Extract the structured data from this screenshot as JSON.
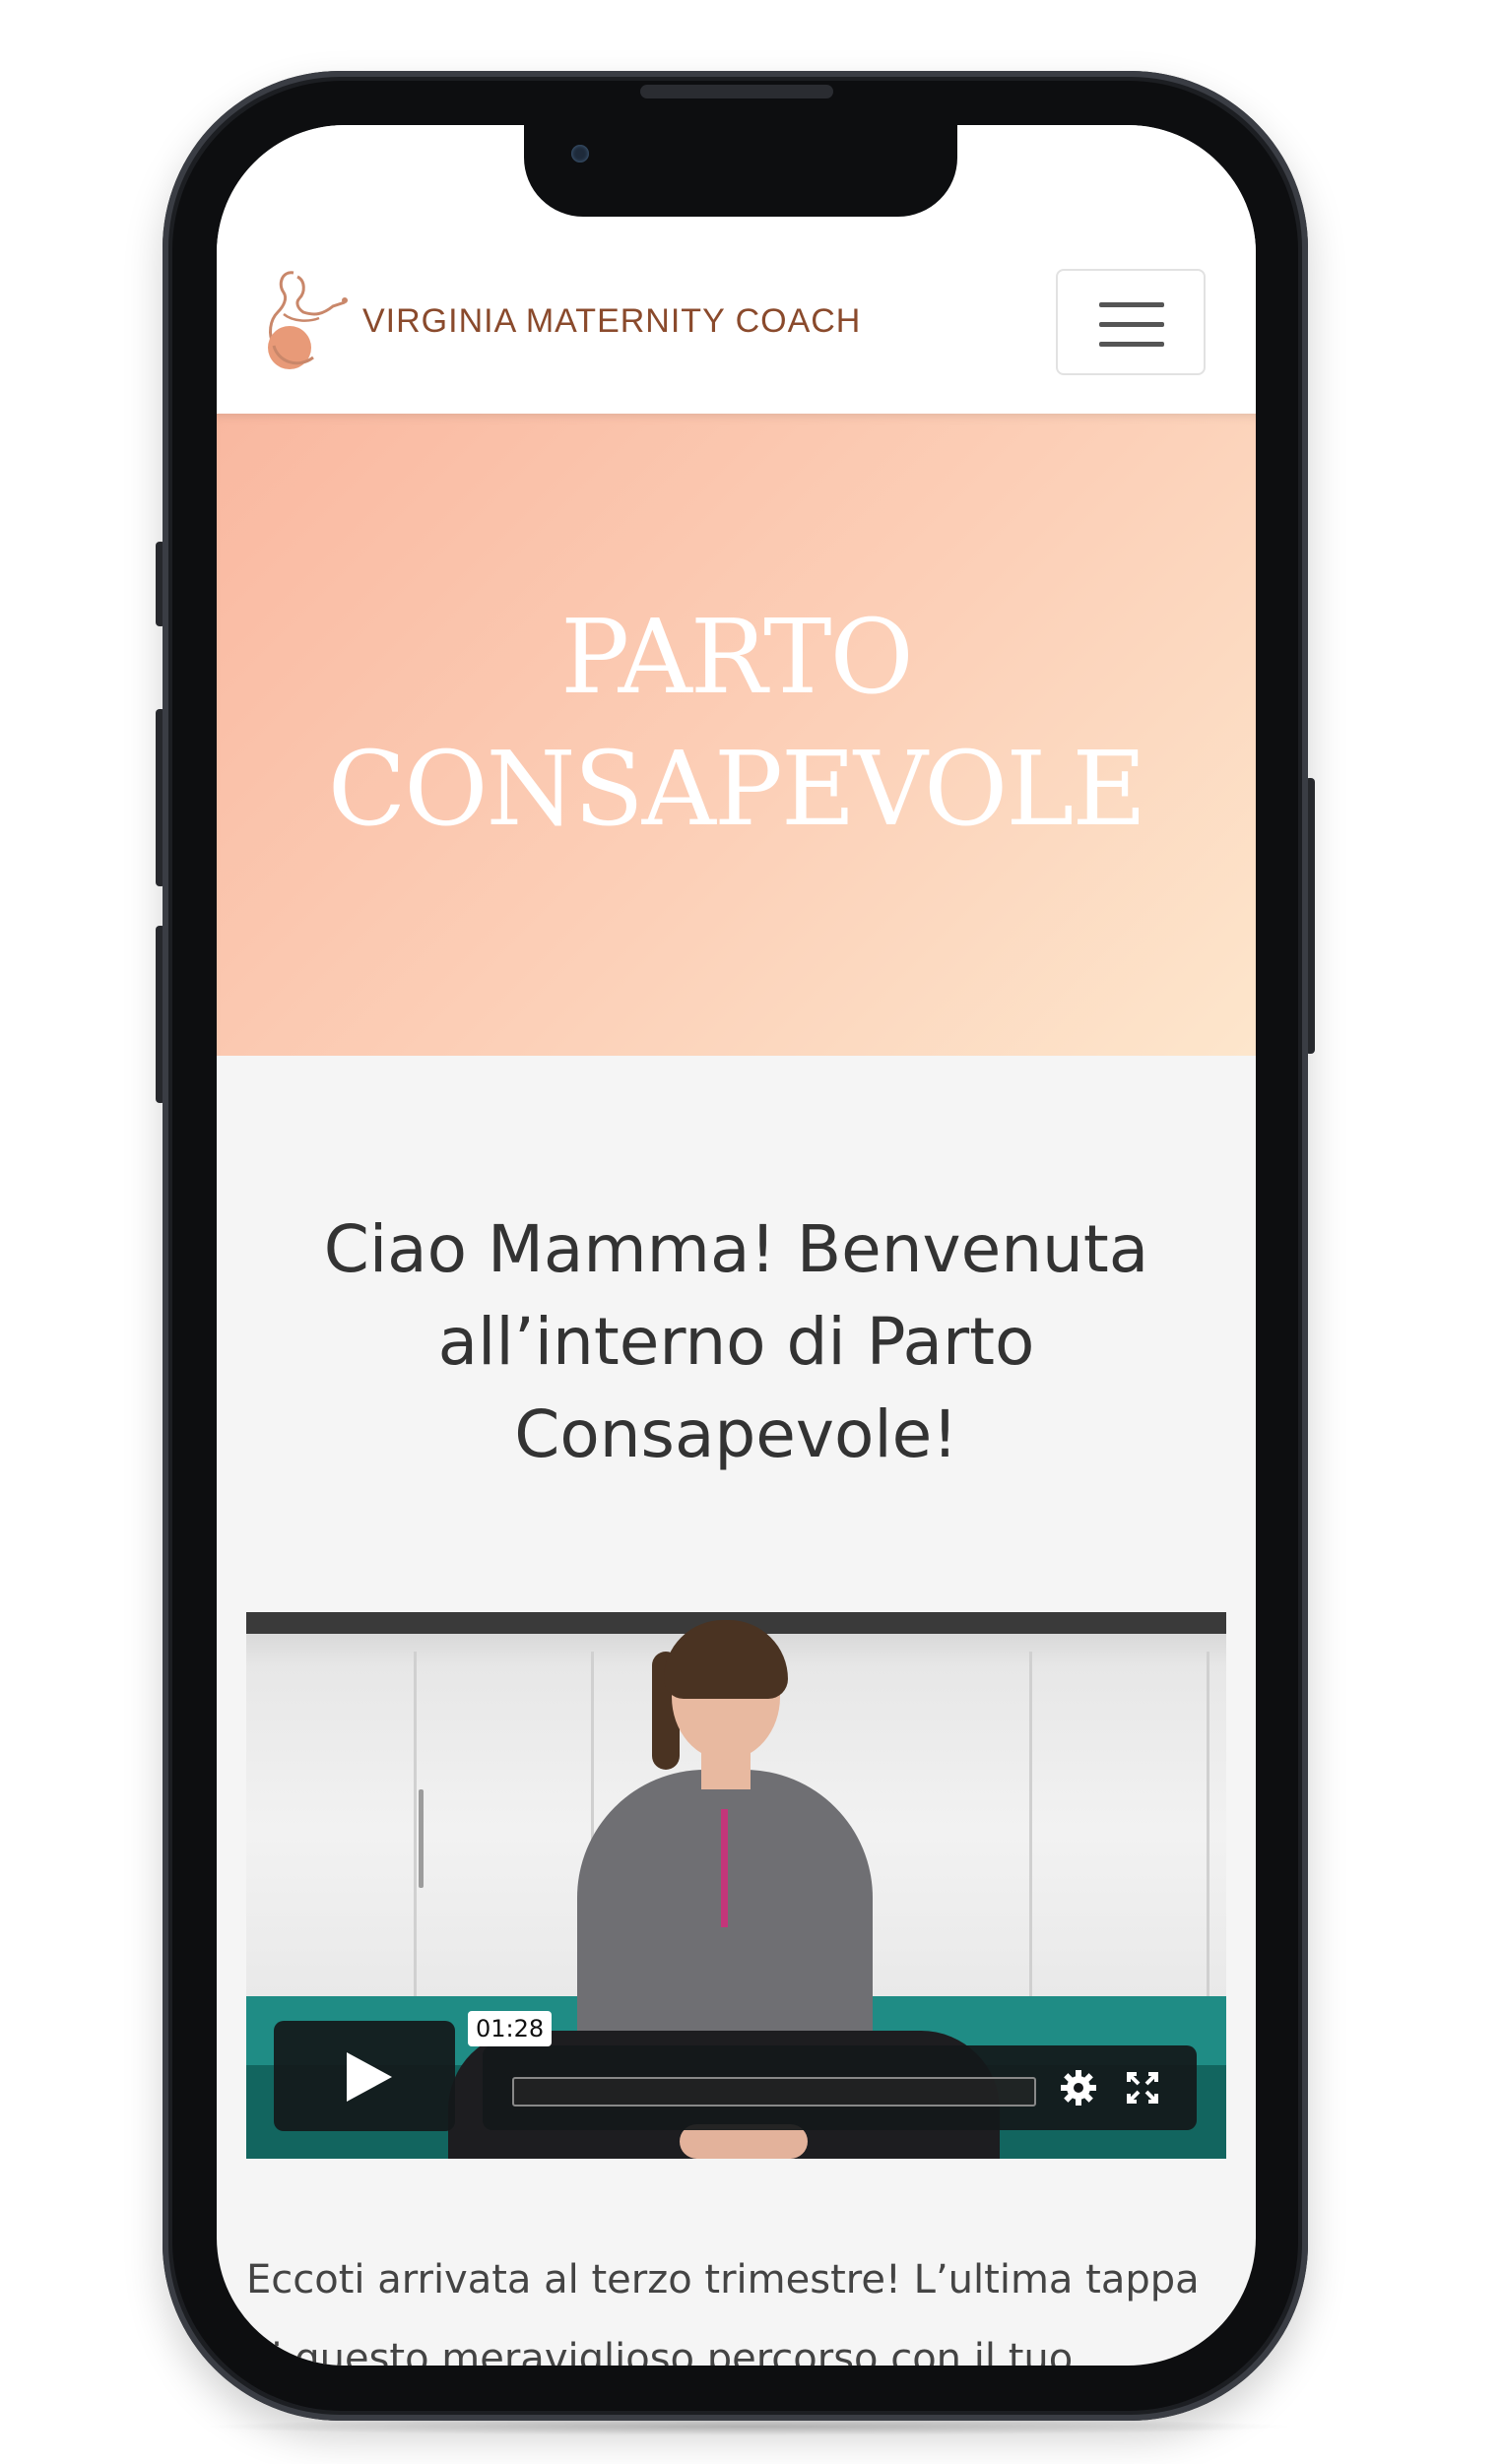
{
  "brand": {
    "name": "VIRGINIA MATERNITY COACH",
    "primary_color": "#8a4a2c",
    "logo_icon": "pregnant-woman-logo"
  },
  "navbar": {
    "menu_icon": "hamburger-menu-icon"
  },
  "hero": {
    "title_line1": "PARTO",
    "title_line2": "CONSAPEVOLE",
    "gradient_colors": [
      "#f9b8a0",
      "#fcd0b8",
      "#fde6cc"
    ]
  },
  "welcome": {
    "line1": "Ciao Mamma! Benvenuta",
    "line2": "all’interno di Parto",
    "line3": "Consapevole!"
  },
  "video": {
    "current_time": "01:28",
    "play_icon": "play-icon",
    "settings_icon": "gear-icon",
    "fullscreen_icon": "fullscreen-icon"
  },
  "body": {
    "line1": "Eccoti arrivata al terzo trimestre! L’ultima tappa",
    "line2": "di questo meraviglioso percorso con il tuo"
  }
}
